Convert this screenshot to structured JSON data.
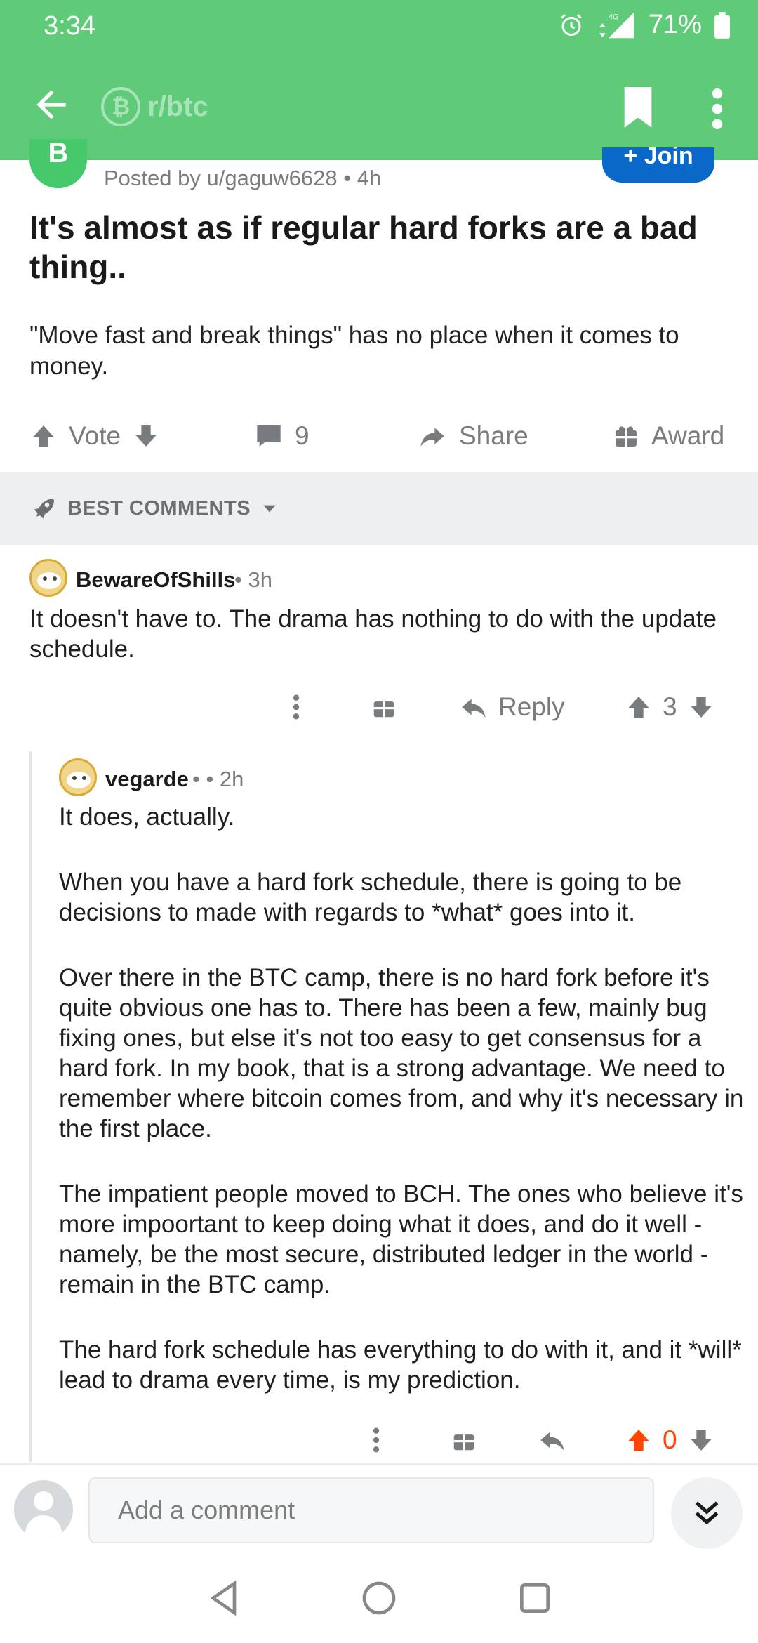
{
  "status_bar": {
    "time": "3:34",
    "network": "4G",
    "battery": "71%"
  },
  "app_bar": {
    "subreddit": "r/btc",
    "subreddit_icon": "bitcoin-cash-icon"
  },
  "post": {
    "avatar_letter": "B",
    "posted_by": "Posted by u/gaguw6628 • 4h",
    "join_label": "+ Join",
    "title": "It's almost as if regular hard forks are a bad thing..",
    "body": "\"Move fast and break things\" has no place when it comes to money.",
    "actions": {
      "vote_label": "Vote",
      "comments_count": "9",
      "share_label": "Share",
      "award_label": "Award"
    }
  },
  "sort": {
    "label": "BEST COMMENTS"
  },
  "comments": [
    {
      "author": "BewareOfShills",
      "meta": "• 3h",
      "body": [
        "It doesn't have to. The drama has nothing to do with the update schedule."
      ],
      "reply_label": "Reply",
      "score": "3"
    },
    {
      "author": "vegarde",
      "meta": "• • 2h",
      "body": [
        "It does, actually.",
        "When you have a hard fork schedule, there is going to be decisions to made with regards to *what* goes into it.",
        "Over there in the BTC camp, there is no hard fork before it's quite obvious one has to. There has been a few, mainly bug fixing ones, but else it's not too easy to get consensus for a hard fork. In my book, that is a strong advantage. We need to remember where bitcoin comes from, and why it's necessary in the first place.",
        "The impatient people moved to BCH. The ones who believe it's more impoortant to keep doing what it does, and do it well - namely, be the most secure, distributed ledger in the world - remain in the BTC camp.",
        "The hard fork schedule has everything to do with it, and it *will* lead to drama every time, is my prediction."
      ],
      "score": "0"
    }
  ],
  "compose": {
    "placeholder": "Add a comment"
  },
  "colors": {
    "header_green": "#5fcb79",
    "join_blue": "#0a68c8",
    "upvote_orange": "#ff4500",
    "muted_gray": "#787c7e"
  }
}
